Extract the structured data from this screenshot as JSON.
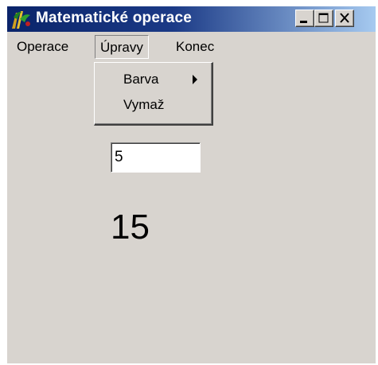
{
  "window": {
    "title": "Matematické operace"
  },
  "titlebar_buttons": {
    "minimize_icon": "minimize-icon",
    "maximize_icon": "maximize-icon",
    "close_icon": "close-icon"
  },
  "menubar": {
    "items": [
      {
        "label": "Operace"
      },
      {
        "label": "Úpravy",
        "open": true
      },
      {
        "label": "Konec"
      }
    ]
  },
  "dropdown": {
    "items": [
      {
        "label": "Barva",
        "submenu": true
      },
      {
        "label": "Vymaž"
      }
    ]
  },
  "input": {
    "value": "5"
  },
  "result": {
    "value": "15"
  },
  "colors": {
    "title_bar_start": "#0a246a",
    "title_bar_end": "#a6caf0",
    "window_face": "#d8d4cf"
  }
}
